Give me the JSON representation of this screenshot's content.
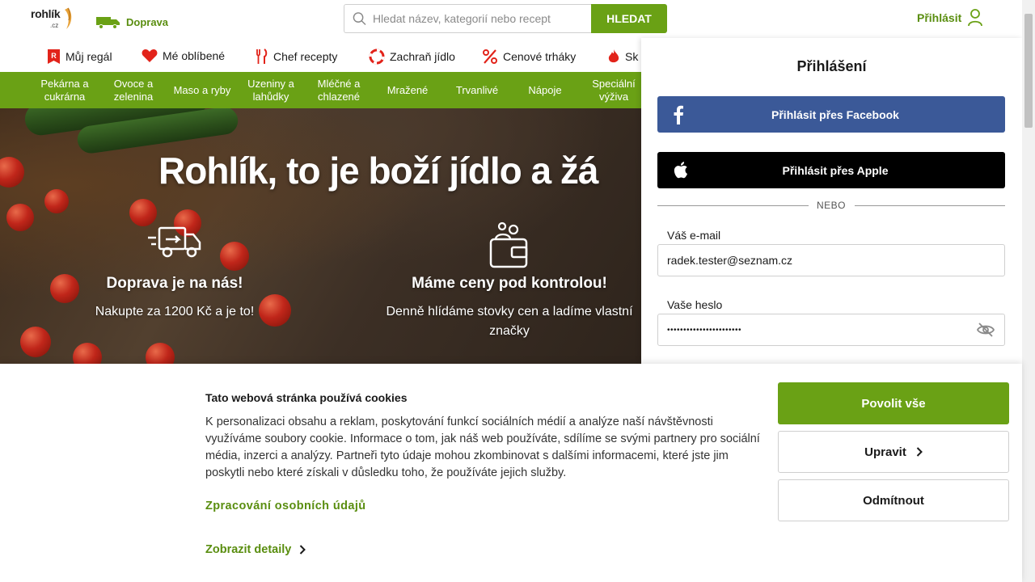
{
  "header": {
    "logo_text": "rohlík",
    "logo_suffix": ".cz",
    "delivery_label": "Doprava",
    "search_placeholder": "Hledat název, kategorií nebo recept",
    "search_button": "HLEDAT",
    "login_label": "Přihlásit"
  },
  "subnav": {
    "items": [
      {
        "label": "Můj regál",
        "icon": "shelf-icon"
      },
      {
        "label": "Mé oblíbené",
        "icon": "heart-icon"
      },
      {
        "label": "Chef recepty",
        "icon": "cutlery-icon"
      },
      {
        "label": "Zachraň jídlo",
        "icon": "lifebuoy-icon"
      },
      {
        "label": "Cenové trháky",
        "icon": "percent-icon"
      },
      {
        "label": "Sk",
        "icon": "flame-icon"
      }
    ]
  },
  "categories": [
    "Pekárna a cukrárna",
    "Ovoce a zelenina",
    "Maso a ryby",
    "Uzeniny a lahůdky",
    "Mléčné a chlazené",
    "Mražené",
    "Trvanlivé",
    "Nápoje",
    "Speciální výživa"
  ],
  "hero": {
    "headline": "Rohlík, to je boží jídlo a žá",
    "features": [
      {
        "title": "Doprava je na nás!",
        "desc": "Nakupte za 1200 Kč a je to!"
      },
      {
        "title": "Máme ceny pod kontrolou!",
        "desc": "Denně hlídáme stovky cen a ladíme vlastní značky"
      }
    ]
  },
  "login": {
    "title": "Přihlášení",
    "facebook_label": "Přihlásit přes Facebook",
    "apple_label": "Přihlásit přes Apple",
    "or_label": "NEBO",
    "email_label": "Váš e-mail",
    "email_value": "radek.tester@seznam.cz",
    "password_label": "Vaše heslo",
    "password_value": "•••••••••••••••••••••••"
  },
  "cookie": {
    "title": "Tato webová stránka používá cookies",
    "body": "K personalizaci obsahu a reklam, poskytování funkcí sociálních médií a analýze naší návštěvnosti využíváme soubory cookie. Informace o tom, jak náš web používáte, sdílíme se svými partnery pro sociální média, inzerci a analýzy. Partneři tyto údaje mohou zkombinovat s dalšími informacemi, které jste jim poskytli nebo které získali v důsledku toho, že používáte jejich služby.",
    "privacy_link": "Zpracování osobních údajů",
    "details_link": "Zobrazit detaily",
    "allow_all": "Povolit vše",
    "edit": "Upravit",
    "reject": "Odmítnout"
  },
  "colors": {
    "brand_green": "#6aa115",
    "link_green": "#5a8e10",
    "facebook_blue": "#3b5998",
    "apple_black": "#000000",
    "icon_red": "#e2231a"
  }
}
